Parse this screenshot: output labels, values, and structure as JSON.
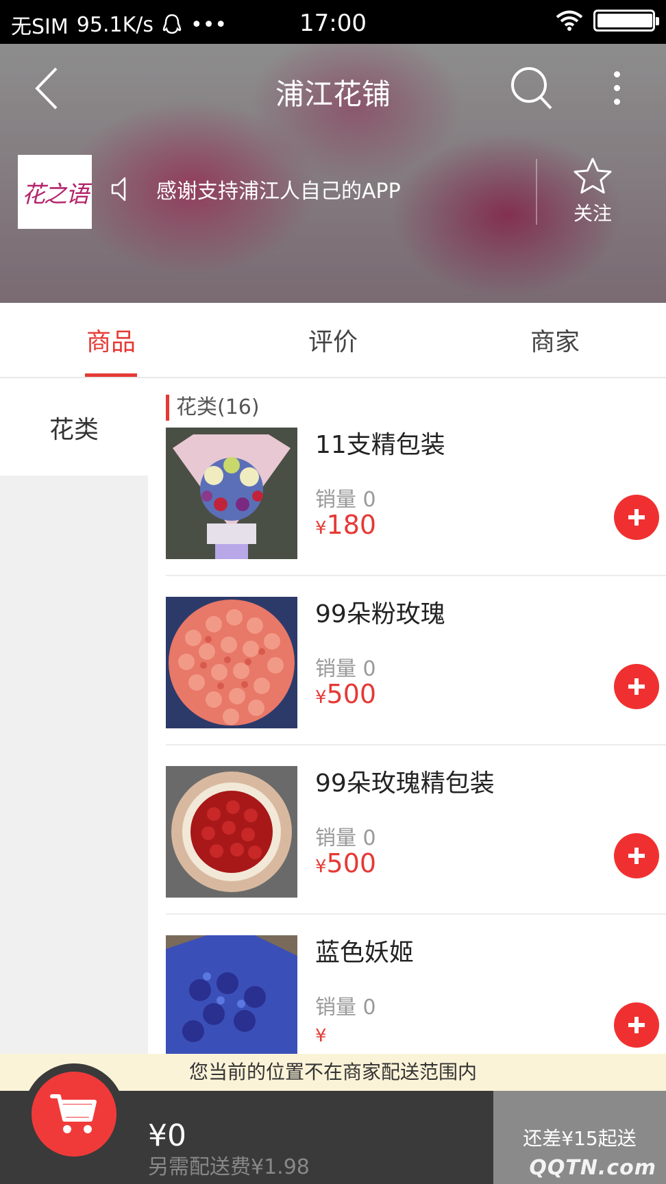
{
  "status_bar": {
    "carrier": "无SIM",
    "speed": "95.1K/s",
    "dots": "•••",
    "time": "17:00"
  },
  "header": {
    "title": "浦江花铺",
    "logo_text": "花之语",
    "notice": "感谢支持浦江人自己的APP",
    "follow_label": "关注"
  },
  "tabs": [
    {
      "label": "商品",
      "active": true
    },
    {
      "label": "评价",
      "active": false
    },
    {
      "label": "商家",
      "active": false
    }
  ],
  "categories": [
    {
      "label": "花类",
      "active": true
    }
  ],
  "section": {
    "title": "花类(16)"
  },
  "products": [
    {
      "name": "11支精包装",
      "sales": "销量 0",
      "currency": "¥",
      "price": "180"
    },
    {
      "name": "99朵粉玫瑰",
      "sales": "销量 0",
      "currency": "¥",
      "price": "500"
    },
    {
      "name": "99朵玫瑰精包装",
      "sales": "销量 0",
      "currency": "¥",
      "price": "500"
    },
    {
      "name": "蓝色妖姬",
      "sales": "销量 0",
      "currency": "¥",
      "price": ""
    }
  ],
  "range_notice": "您当前的位置不在商家配送范围内",
  "cart": {
    "total": "¥0",
    "delivery_fee": "另需配送费¥1.98",
    "min_order": "还差¥15起送"
  },
  "watermark": "QQTN.com",
  "colors": {
    "accent": "#e53935",
    "add_button": "#f03030",
    "cart_bar": "#3a3a3a",
    "notice_bg": "#fbf3d8"
  }
}
